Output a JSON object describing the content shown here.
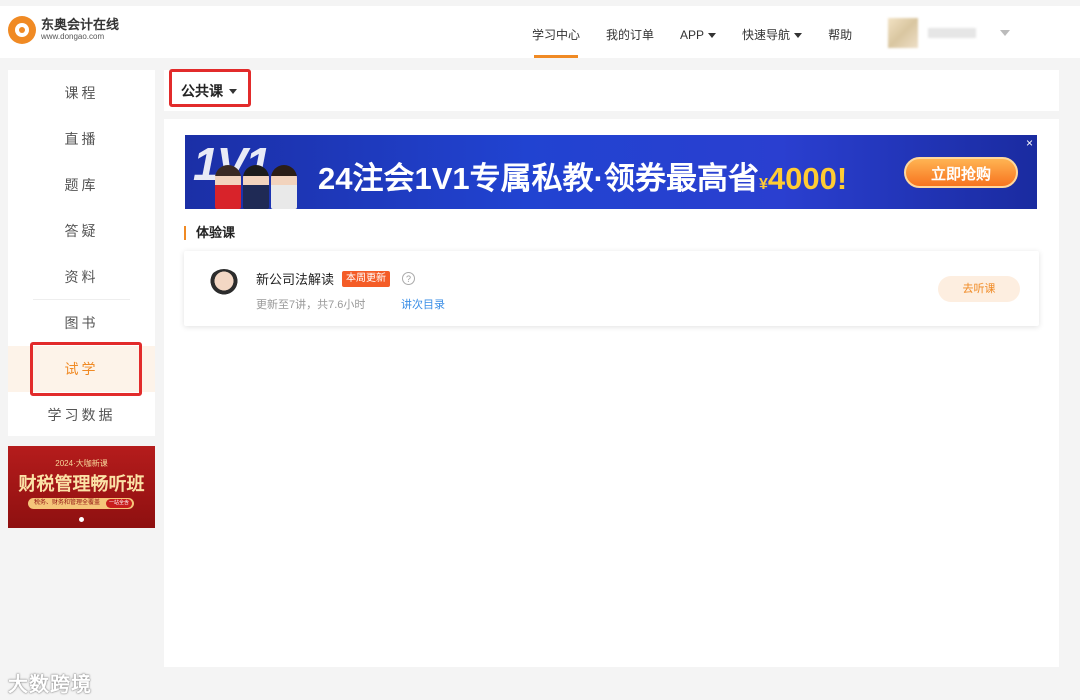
{
  "header": {
    "logo_cn": "东奥会计在线",
    "logo_en": "www.dongao.com",
    "nav": [
      {
        "label": "学习中心",
        "active": true
      },
      {
        "label": "我的订单",
        "active": false
      },
      {
        "label": "APP",
        "active": false,
        "dropdown": true
      },
      {
        "label": "快速导航",
        "active": false,
        "dropdown": true
      },
      {
        "label": "帮助",
        "active": false
      }
    ]
  },
  "sidebar": {
    "items": [
      {
        "label": "课程"
      },
      {
        "label": "直播"
      },
      {
        "label": "题库"
      },
      {
        "label": "答疑"
      },
      {
        "label": "资料"
      },
      {
        "label": "图书"
      },
      {
        "label": "试学",
        "active": true
      },
      {
        "label": "学习数据"
      }
    ],
    "promo": {
      "subtitle": "2024·大咖新课",
      "title": "财税管理畅听班",
      "strip": "税务、财务和管理全覆盖",
      "tag": "一站全含"
    }
  },
  "topbar": {
    "selector_label": "公共课"
  },
  "banner": {
    "badge_text": "1V1",
    "text_main": "24注会1V1专属私教·领券最高省",
    "currency": "¥",
    "amount": "4000!",
    "button": "立即抢购",
    "close": "×"
  },
  "section": {
    "title": "体验课"
  },
  "course": {
    "title": "新公司法解读",
    "badge": "本周更新",
    "help": "?",
    "meta": "更新至7讲，共7.6小时",
    "link": "讲次目录",
    "button": "去听课"
  },
  "watermark": "大数跨境",
  "colors": {
    "accent": "#f08a24",
    "highlight_box": "#e22b2b",
    "badge": "#f45c27",
    "link": "#3a8ee6"
  }
}
